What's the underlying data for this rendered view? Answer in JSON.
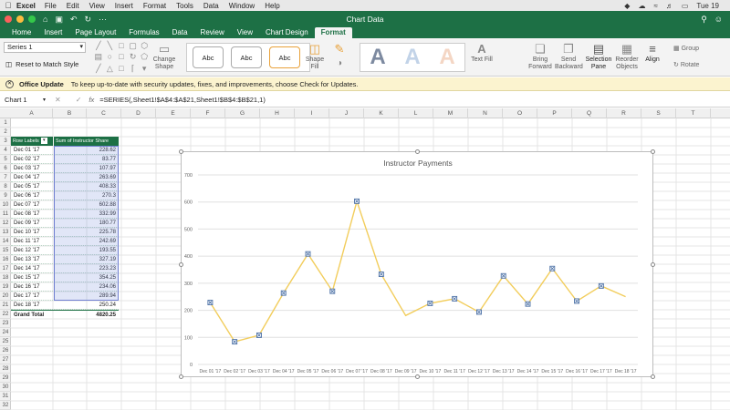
{
  "menubar": {
    "app": "Excel",
    "items": [
      "File",
      "Edit",
      "View",
      "Insert",
      "Format",
      "Tools",
      "Data",
      "Window",
      "Help"
    ],
    "clock": "Tue 19"
  },
  "window": {
    "title": "Chart Data"
  },
  "tabs": [
    "Home",
    "Insert",
    "Page Layout",
    "Formulas",
    "Data",
    "Review",
    "View",
    "Chart Design",
    "Format"
  ],
  "active_tab": "Format",
  "ribbon": {
    "selection": "Series 1",
    "reset_label": "Reset to Match Style",
    "change_shape": "Change Shape",
    "style_sample": "Abc",
    "shape_fill": "Shape Fill",
    "wordart_sample": "A",
    "text_fill": "Text Fill",
    "bring_forward": "Bring Forward",
    "send_backward": "Send Backward",
    "selection_pane": "Selection Pane",
    "reorder_objects": "Reorder Objects",
    "align": "Align",
    "group": "Group",
    "rotate": "Rotate"
  },
  "update_bar": {
    "title": "Office Update",
    "message": "To keep up-to-date with security updates, fixes, and improvements, choose Check for Updates."
  },
  "formula_bar": {
    "name_box": "Chart 1",
    "formula": "=SERIES(,Sheet1!$A$4:$A$21,Sheet1!$B$4:$B$21,1)"
  },
  "columns": [
    "A",
    "B",
    "C",
    "D",
    "E",
    "F",
    "G",
    "H",
    "I",
    "J",
    "K",
    "L",
    "M",
    "N",
    "O",
    "P",
    "Q",
    "R",
    "S",
    "T"
  ],
  "rows": [
    "1",
    "2",
    "3",
    "4",
    "5",
    "6",
    "7",
    "8",
    "9",
    "10",
    "11",
    "12",
    "13",
    "14",
    "15",
    "16",
    "17",
    "18",
    "19",
    "20",
    "21",
    "22",
    "23",
    "24",
    "25",
    "26",
    "27",
    "28",
    "29",
    "30",
    "31",
    "32"
  ],
  "pivot": {
    "header_labels": "Row Labels",
    "header_values": "Sum of Instructor Share",
    "rows": [
      {
        "label": "Dec 01 '17",
        "value": "228.62"
      },
      {
        "label": "Dec 02 '17",
        "value": "83.77"
      },
      {
        "label": "Dec 03 '17",
        "value": "107.97"
      },
      {
        "label": "Dec 04 '17",
        "value": "263.69"
      },
      {
        "label": "Dec 05 '17",
        "value": "408.33"
      },
      {
        "label": "Dec 06 '17",
        "value": "270.3"
      },
      {
        "label": "Dec 07 '17",
        "value": "602.88"
      },
      {
        "label": "Dec 08 '17",
        "value": "332.99"
      },
      {
        "label": "Dec 09 '17",
        "value": "180.77"
      },
      {
        "label": "Dec 10 '17",
        "value": "225.78"
      },
      {
        "label": "Dec 11 '17",
        "value": "242.69"
      },
      {
        "label": "Dec 12 '17",
        "value": "193.55"
      },
      {
        "label": "Dec 13 '17",
        "value": "327.19"
      },
      {
        "label": "Dec 14 '17",
        "value": "223.23"
      },
      {
        "label": "Dec 15 '17",
        "value": "354.25"
      },
      {
        "label": "Dec 16 '17",
        "value": "234.06"
      },
      {
        "label": "Dec 17 '17",
        "value": "289.94"
      },
      {
        "label": "Dec 18 '17",
        "value": "250.24"
      }
    ],
    "total_label": "Grand Total",
    "total_value": "4820.25"
  },
  "chart_data": {
    "type": "line",
    "title": "Instructor Payments",
    "categories": [
      "Dec 01 '17",
      "Dec 02 '17",
      "Dec 03 '17",
      "Dec 04 '17",
      "Dec 05 '17",
      "Dec 06 '17",
      "Dec 07 '17",
      "Dec 08 '17",
      "Dec 09 '17",
      "Dec 10 '17",
      "Dec 11 '17",
      "Dec 12 '17",
      "Dec 13 '17",
      "Dec 14 '17",
      "Dec 15 '17",
      "Dec 16 '17",
      "Dec 17 '17",
      "Dec 18 '17"
    ],
    "values": [
      228.62,
      83.77,
      107.97,
      263.69,
      408.33,
      270.3,
      602.88,
      332.99,
      180.77,
      225.78,
      242.69,
      193.55,
      327.19,
      223.23,
      354.25,
      234.06,
      289.94,
      250.24
    ],
    "marker_indices": [
      0,
      1,
      2,
      3,
      4,
      5,
      6,
      7,
      9,
      10,
      11,
      12,
      13,
      14,
      15,
      16
    ],
    "ylim": [
      0,
      700
    ],
    "yticks": [
      0,
      100,
      200,
      300,
      400,
      500,
      600,
      700
    ],
    "grid": true,
    "legend": "none",
    "line_color": "#f2cd5c",
    "marker_color": "#4a6fa5"
  },
  "colors": {
    "excel_green": "#1d7045",
    "ribbon_bg": "#f3f3f3",
    "update_bg": "#fbf3cf",
    "selection_blue": "#6f7fd0"
  }
}
